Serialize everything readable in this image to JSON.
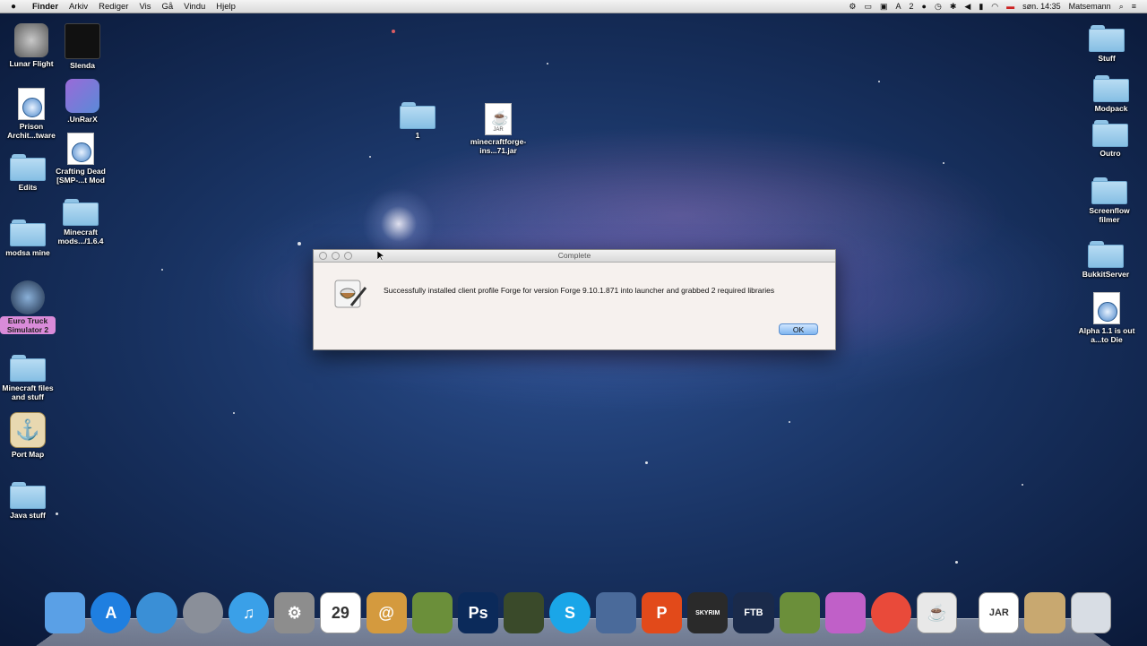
{
  "menubar": {
    "apple": "",
    "items": [
      "Finder",
      "Arkiv",
      "Rediger",
      "Vis",
      "Gå",
      "Vindu",
      "Hjelp"
    ],
    "status": {
      "notifications": "2",
      "clock": "søn. 14:35",
      "user": "Matsemann"
    }
  },
  "desktop": {
    "left_col1": [
      {
        "label": "Lunar Flight"
      },
      {
        "label": "Prison Archit...tware"
      },
      {
        "label": "Edits"
      },
      {
        "label": "modsa mine"
      },
      {
        "label": "Euro Truck Simulator 2"
      },
      {
        "label": "Minecraft files and stuff"
      },
      {
        "label": "Port Map"
      },
      {
        "label": "Java stuff"
      }
    ],
    "left_col2": [
      {
        "label": "Slenda"
      },
      {
        "label": ".UnRarX"
      },
      {
        "label": "Crafting Dead [SMP-...t Mod"
      },
      {
        "label": "Minecraft mods.../1.6.4"
      }
    ],
    "center": [
      {
        "label": "1"
      },
      {
        "label": "minecraftforge-ins...71.jar",
        "tag": "JAR"
      }
    ],
    "right_col": [
      {
        "label": "Stuff"
      },
      {
        "label": "Modpack"
      },
      {
        "label": "Outro"
      },
      {
        "label": "Screenflow filmer"
      },
      {
        "label": "BukkitServer"
      },
      {
        "label": "Alpha 1.1 is out a...to Die"
      }
    ]
  },
  "dialog": {
    "title": "Complete",
    "message": "Successfully installed client profile Forge for version Forge 9.10.1.871 into launcher and grabbed 2 required libraries",
    "ok_label": "OK"
  },
  "dock": {
    "items": [
      {
        "name": "finder",
        "color": "#5aa0e6"
      },
      {
        "name": "app-store",
        "color": "#1f7fe0",
        "glyph": "A"
      },
      {
        "name": "safari",
        "color": "#3a8fd6"
      },
      {
        "name": "launchpad",
        "color": "#8a8f99"
      },
      {
        "name": "itunes",
        "color": "#3aa0e8",
        "glyph": "♫"
      },
      {
        "name": "system-preferences",
        "color": "#8d8d8d",
        "glyph": "⚙"
      },
      {
        "name": "calendar",
        "color": "#ffffff",
        "glyph": "29"
      },
      {
        "name": "address-book",
        "color": "#d49a3e",
        "glyph": "@"
      },
      {
        "name": "minecraft",
        "color": "#6b8f3a"
      },
      {
        "name": "photoshop",
        "color": "#0b2a5a",
        "glyph": "Ps"
      },
      {
        "name": "game-app",
        "color": "#3a4a2a"
      },
      {
        "name": "skype",
        "color": "#1aa6e8",
        "glyph": "S"
      },
      {
        "name": "video-app",
        "color": "#4a6a9a"
      },
      {
        "name": "powerpoint",
        "color": "#e24a1a",
        "glyph": "P"
      },
      {
        "name": "skyrim",
        "color": "#2a2a2a",
        "glyph": "SKYRIM"
      },
      {
        "name": "ftb",
        "color": "#1a2a4a",
        "glyph": "FTB"
      },
      {
        "name": "minecraft-2",
        "color": "#6b8f3a"
      },
      {
        "name": "display-app",
        "color": "#c060c8"
      },
      {
        "name": "chrome",
        "color": "#e94a3a"
      },
      {
        "name": "java-app",
        "color": "#e8e8e8",
        "glyph": "☕"
      },
      {
        "name": "jar-file",
        "color": "#ffffff",
        "glyph": "JAR"
      },
      {
        "name": "downloads-stack",
        "color": "#c8a870"
      },
      {
        "name": "trash",
        "color": "#d8dde4"
      }
    ]
  }
}
